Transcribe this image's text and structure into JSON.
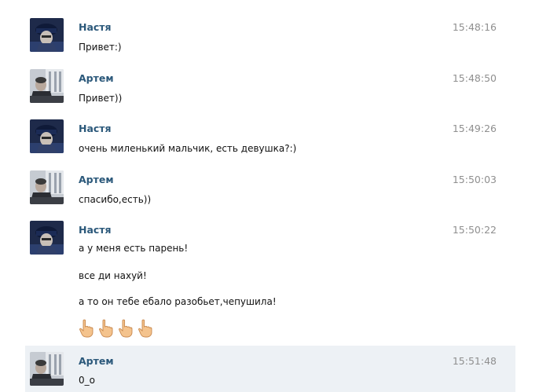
{
  "messages": [
    {
      "author": "Настя",
      "time": "15:48:16",
      "avatar": "girl-avatar",
      "lines": [
        "Привет:)"
      ]
    },
    {
      "author": "Артем",
      "time": "15:48:50",
      "avatar": "boy-avatar",
      "lines": [
        "Привет))"
      ]
    },
    {
      "author": "Настя",
      "time": "15:49:26",
      "avatar": "girl-avatar",
      "lines": [
        "очень миленький мальчик, есть девушка?:)"
      ]
    },
    {
      "author": "Артем",
      "time": "15:50:03",
      "avatar": "boy-avatar",
      "lines": [
        "спасибо,есть))"
      ]
    },
    {
      "author": "Настя",
      "time": "15:50:22",
      "avatar": "girl-avatar",
      "lines": [
        "а у меня есть парень!",
        "все ди нахуй!",
        "а то он тебе ебало разобьет,чепушила!"
      ],
      "emoji": [
        "pointing-hand-icon",
        "pointing-hand-icon",
        "pointing-hand-icon",
        "pointing-hand-icon"
      ]
    },
    {
      "author": "Артем",
      "time": "15:51:48",
      "avatar": "boy-avatar",
      "lines": [
        "0_о"
      ],
      "highlighted": true
    }
  ],
  "colors": {
    "author": "#2b587a",
    "time": "#8f8f8f",
    "highlight": "#edf1f5"
  }
}
